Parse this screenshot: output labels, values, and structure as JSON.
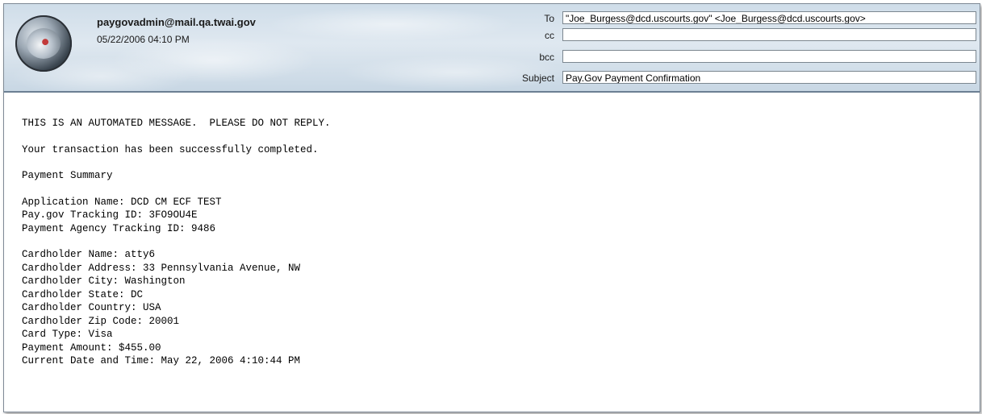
{
  "header": {
    "sender": "paygovadmin@mail.qa.twai.gov",
    "date": "05/22/2006 04:10 PM",
    "fields": {
      "to_label": "To",
      "to_value": "\"Joe_Burgess@dcd.uscourts.gov\" <Joe_Burgess@dcd.uscourts.gov>",
      "cc_label": "cc",
      "cc_value": "",
      "bcc_label": "bcc",
      "bcc_value": "",
      "subject_label": "Subject",
      "subject_value": "Pay.Gov Payment Confirmation"
    }
  },
  "message": {
    "line1": "THIS IS AN AUTOMATED MESSAGE.  PLEASE DO NOT REPLY.",
    "line2": "Your transaction has been successfully completed.",
    "line3": "Payment Summary",
    "app_name": "Application Name: DCD CM ECF TEST",
    "paygov_id": "Pay.gov Tracking ID: 3FO9OU4E",
    "agency_id": "Payment Agency Tracking ID: 9486",
    "card_name": "Cardholder Name: atty6",
    "card_address": "Cardholder Address: 33 Pennsylvania Avenue, NW",
    "card_city": "Cardholder City: Washington",
    "card_state": "Cardholder State: DC",
    "card_country": "Cardholder Country: USA",
    "card_zip": "Cardholder Zip Code: 20001",
    "card_type": "Card Type: Visa",
    "amount": "Payment Amount: $455.00",
    "datetime": "Current Date and Time: May 22, 2006 4:10:44 PM"
  }
}
